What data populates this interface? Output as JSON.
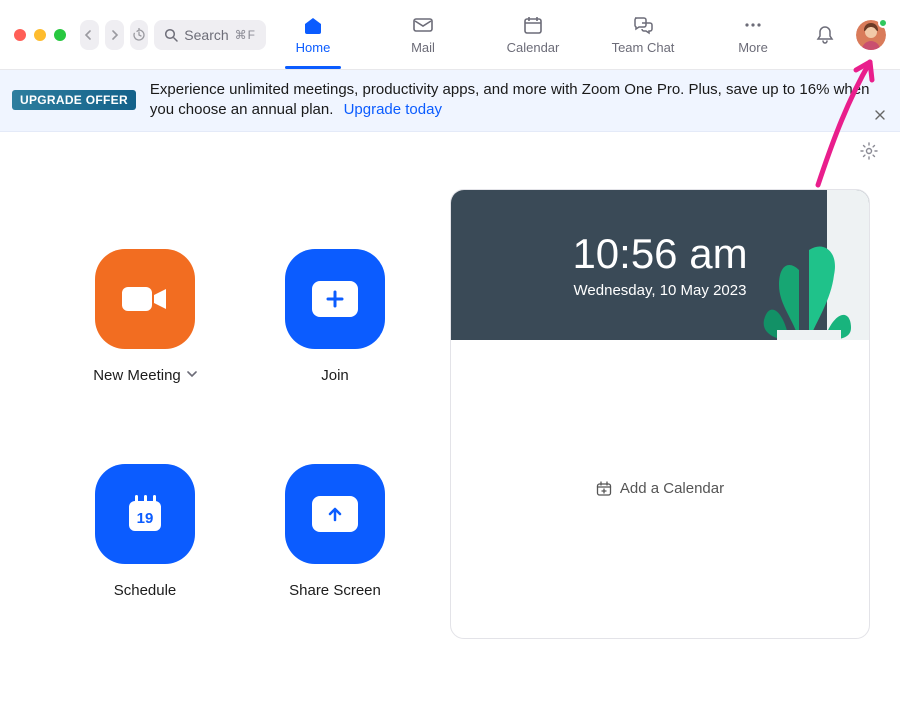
{
  "search": {
    "placeholder": "Search",
    "shortcut": "⌘F"
  },
  "tabs": [
    {
      "label": "Home",
      "icon": "home"
    },
    {
      "label": "Mail",
      "icon": "mail"
    },
    {
      "label": "Calendar",
      "icon": "calendar"
    },
    {
      "label": "Team Chat",
      "icon": "chat"
    },
    {
      "label": "More",
      "icon": "more"
    }
  ],
  "active_tab": "Home",
  "banner": {
    "badge": "UPGRADE OFFER",
    "text": "Experience unlimited meetings, productivity apps, and more with Zoom One Pro. Plus, save up to 16% when you choose an annual plan.",
    "link": "Upgrade today"
  },
  "actions": {
    "new_meeting": "New Meeting",
    "join": "Join",
    "schedule": "Schedule",
    "schedule_day": "19",
    "share_screen": "Share Screen"
  },
  "calendar_panel": {
    "time": "10:56 am",
    "date": "Wednesday, 10 May 2023",
    "add_label": "Add a Calendar"
  },
  "status": {
    "presence": "online"
  }
}
